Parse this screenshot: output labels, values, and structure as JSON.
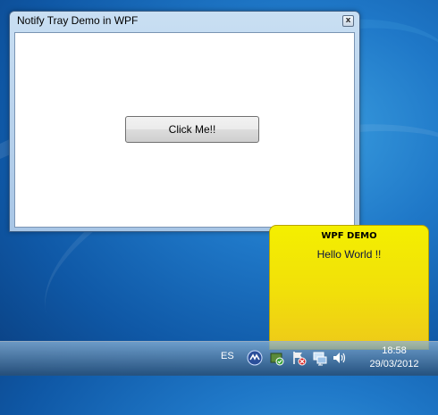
{
  "window": {
    "title": "Notify Tray Demo in WPF",
    "close_label": "x",
    "button_label": "Click Me!!"
  },
  "notification": {
    "title": "WPF DEMO",
    "message": "Hello World !!",
    "background_color": "#f1df0a"
  },
  "taskbar": {
    "language": "ES",
    "tray_icons": [
      "network-sync-icon",
      "security-shield-icon",
      "action-center-flag-icon",
      "network-icon",
      "volume-icon"
    ],
    "time": "18:58",
    "date": "29/03/2012"
  }
}
